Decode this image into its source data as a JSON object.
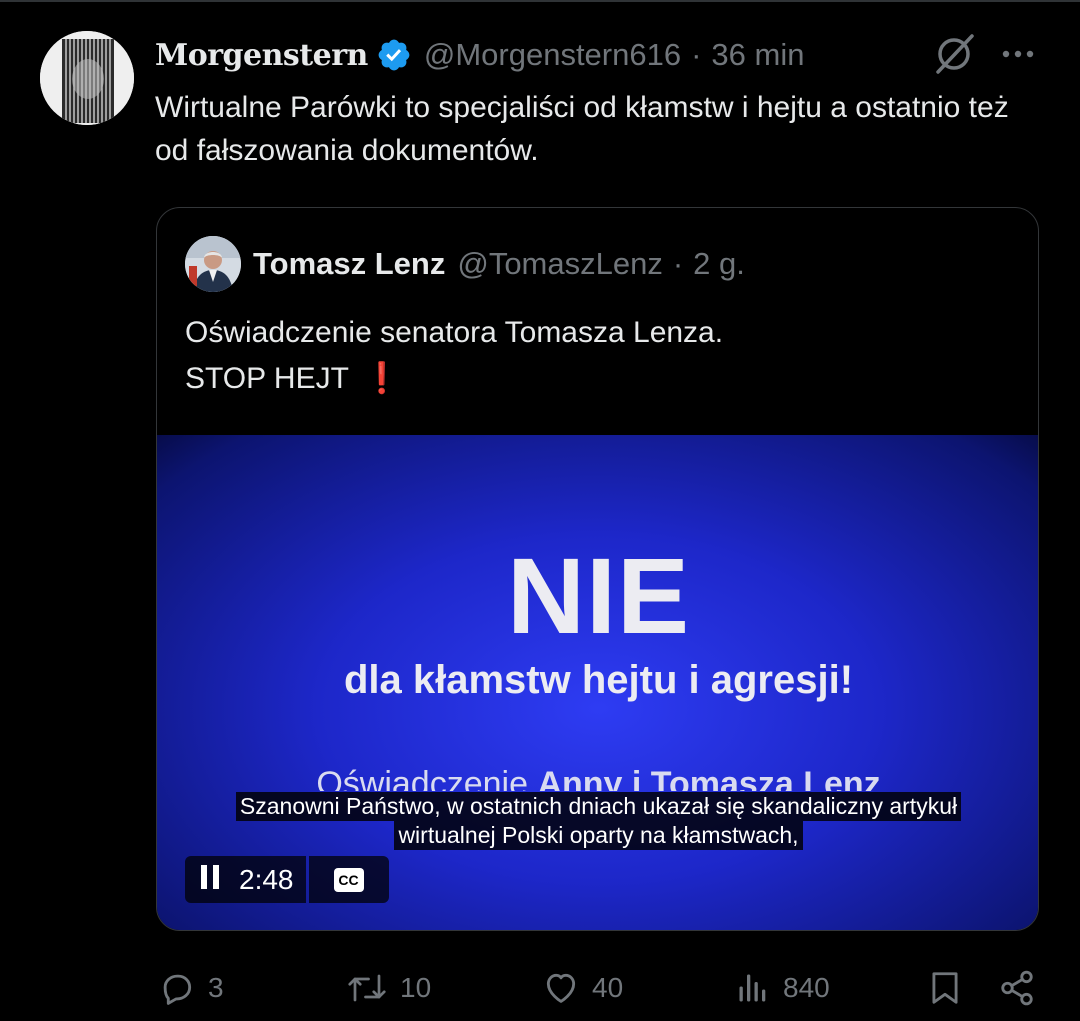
{
  "tweet": {
    "display_name": "Morgenstern",
    "handle": "@Morgenstern616",
    "separator": "·",
    "time": "36 min",
    "text": "Wirtualne Parówki to specjaliści od kłamstw i hejtu a ostatnio też od fałszowania dokumentów."
  },
  "quote": {
    "display_name": "Tomasz Lenz",
    "handle": "@TomaszLenz",
    "separator": "·",
    "time": "2 g.",
    "text_line1": "Oświadczenie senatora Tomasza Lenza.",
    "text_line2": "STOP HEJT",
    "emoji": "❗"
  },
  "video": {
    "title": "NIE",
    "subtitle": "dla kłamstw hejtu i agresji!",
    "statement_prefix": "Oświadczenie ",
    "statement_names": "Anny i Tomasza Lenz",
    "caption_line1": "Szanowni Państwo, w ostatnich dniach ukazał się skandaliczny artykuł",
    "caption_line2": "wirtualnej Polski oparty na kłamstwach,",
    "time_remaining": "2:48",
    "cc_label": "CC",
    "background_color": "#1d27c9"
  },
  "actions": {
    "replies": "3",
    "reposts": "10",
    "likes": "40",
    "views": "840"
  },
  "colors": {
    "background": "#000000",
    "text": "#e7e9ea",
    "muted": "#71767b",
    "verified": "#1d9bf0",
    "border": "#333639"
  },
  "icons": [
    "verified-badge-icon",
    "grok-icon",
    "more-icon",
    "pause-icon",
    "cc-icon",
    "reply-icon",
    "repost-icon",
    "like-icon",
    "views-icon",
    "bookmark-icon",
    "share-icon"
  ]
}
